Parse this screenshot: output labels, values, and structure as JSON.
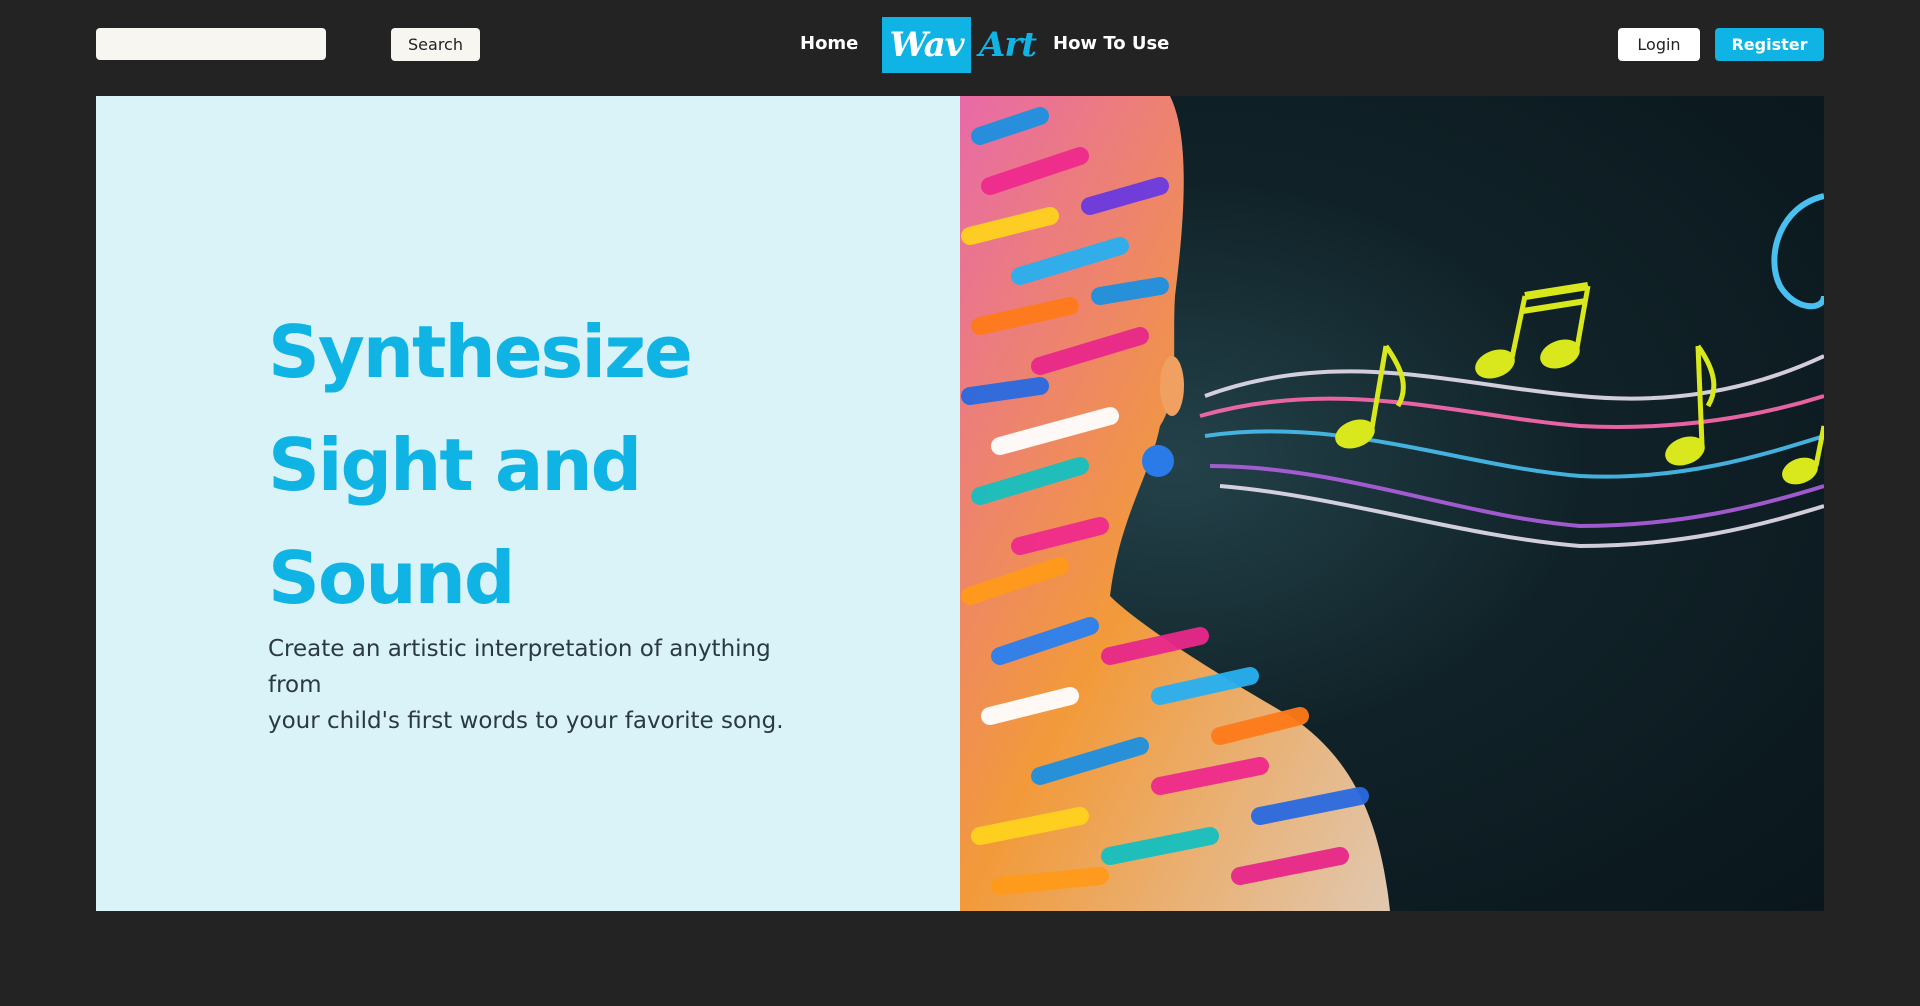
{
  "header": {
    "search": {
      "value": "",
      "placeholder": ""
    },
    "search_button_label": "Search",
    "nav": {
      "home_label": "Home",
      "how_to_use_label": "How To Use"
    },
    "logo": {
      "part1": "Wav",
      "part2": "Art"
    },
    "login_label": "Login",
    "register_label": "Register"
  },
  "hero": {
    "heading_lines": [
      "Synthesize",
      "Sight and",
      "Sound"
    ],
    "subtext_lines": [
      "Create an artistic interpretation of anything from",
      "your child's first words to your favorite song."
    ],
    "image": {
      "description_icon": "painted-face-music-notes-image"
    }
  },
  "colors": {
    "page_background": "#232323",
    "accent": "#10b4e4",
    "hero_left_background": "#d9f3f8",
    "button_light": "#f7f6f1",
    "note_color": "#d8e81c"
  }
}
